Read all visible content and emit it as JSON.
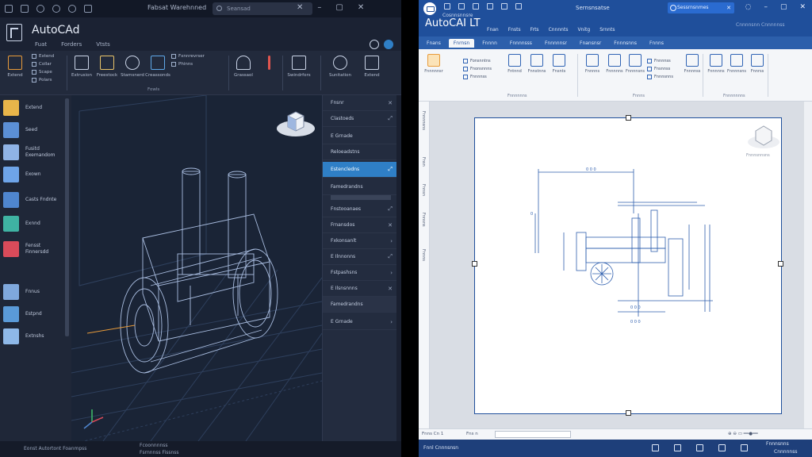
{
  "left_app": {
    "window_title": "Fabsat Warehnned",
    "search_placeholder": "Seansad",
    "app_name": "AutoCAd",
    "tabs": [
      "Fuat",
      "Forders",
      "Vtsts"
    ],
    "ribbon": {
      "list1": [
        "Extend",
        "Collar",
        "Scape",
        "Polars"
      ],
      "tools": [
        "Extrusion",
        "Freestock",
        "Stamsnerd",
        "Creassonds",
        "Grassaol",
        "Swindrfors",
        "Sunitation"
      ],
      "list2": [
        "Fxnnrevrser",
        "Phinns"
      ],
      "groups": [
        "Fowls"
      ]
    },
    "sidebar": [
      "Extend",
      "Seed",
      "Fusitd Exemandom",
      "Exown",
      "Casts Fndnte",
      "Exnnd",
      "Fensst Finnersdd",
      "Fnnus",
      "Estpnd",
      "Extnshs"
    ],
    "panel": {
      "header": "Fnsnr",
      "rows": [
        "Clastoeds",
        "E Grnade",
        "Reloeadstns",
        "Estencledns",
        "Famedrandns",
        "Fnstooanaes",
        "Frnansdos",
        "Fxkonsanlt",
        "E Ilnnonns",
        "Fstpashsns",
        "E Ilsnsnnns"
      ],
      "active_index": 3
    },
    "status": {
      "left": "Eonst Autortont Foanmpss",
      "mid": "Fcoonnnnss",
      "mid2": "Fsrnnnss Fissnss"
    },
    "colors": {
      "bg": "#1b2233",
      "accent": "#2f7fc6",
      "wire": "#a9bde0"
    }
  },
  "right_app": {
    "window_title": "Sernsnsatse",
    "subtitle": "Cosnnsnnsre",
    "search_text": "Sessrnsnmes",
    "app_name": "AutoCAI LT",
    "tabs": [
      "Fnan",
      "Fnsts",
      "Frts",
      "Cnnnnts",
      "Vnitg",
      "Srnnts"
    ],
    "sub_tabs": [
      "Fnans",
      "Fnrnsn",
      "Fnnnn",
      "Fnnnnsss",
      "Fnnnnnsr",
      "Fnansnsr",
      "Fnnnsnns",
      "Fnnns"
    ],
    "sub_right": "Cnnnnsnn Cnnnnnss",
    "ribbon": {
      "tools": [
        "Fnnnnnsr",
        "Fntnnd",
        "Fnnstnns",
        "Fnsnts",
        "Fnnnns",
        "Fnnnnns",
        "Fnnnnsns",
        "Fnnrss"
      ],
      "list1": [
        "Fonsnntns",
        "Fnonsnnns",
        "Fnnnnss"
      ],
      "list2": [
        "Fnnnnss",
        "Fnsnnss",
        "Fnnnsnns",
        "Fnnnnss"
      ],
      "groups": [
        "Fnnnnnns",
        "Fnnns",
        "Fnnnnnnns"
      ]
    },
    "rail": [
      "Fnnnnsns",
      "Fnsn",
      "Fnnsn",
      "Fnnsns",
      "Fnnns"
    ],
    "status": {
      "left": "Fnns  Cn 1",
      "mid": "Fns n",
      "right": "Fnnnnsns"
    },
    "taskbar": {
      "left": "Fnnl  Cnnnsnsn",
      "right1": "Fnnnsnns",
      "right2": "Cnnnnnss"
    },
    "drawing_label": "Fnnnsnnsns",
    "colors": {
      "title": "#1f4f9b",
      "line": "#2f5fae"
    }
  }
}
